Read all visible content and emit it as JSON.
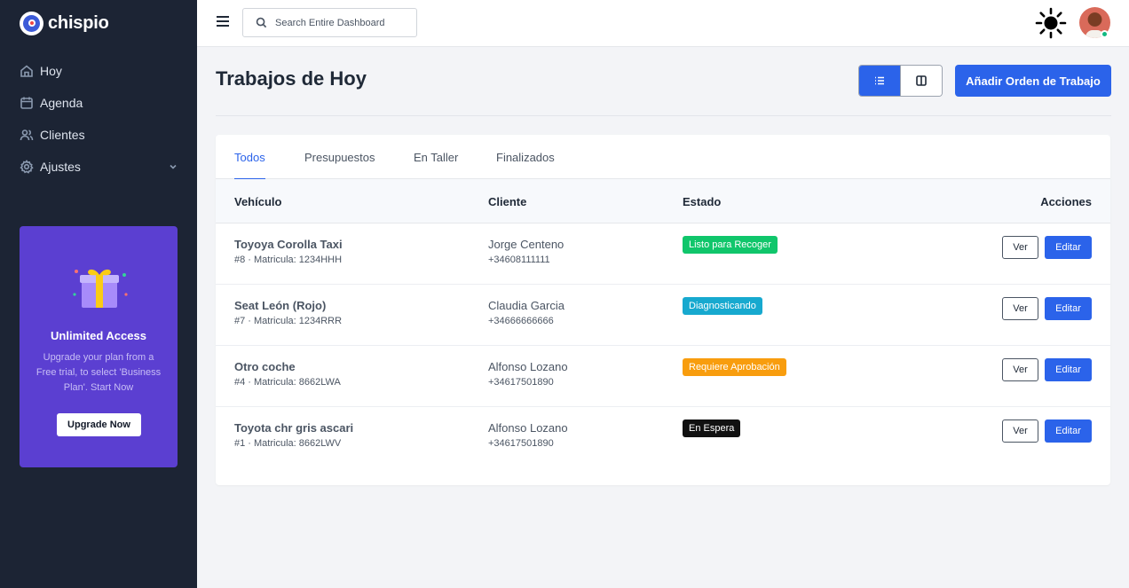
{
  "app": {
    "name": "chispio"
  },
  "sidebar": {
    "items": [
      {
        "label": "Hoy",
        "icon": "home-icon"
      },
      {
        "label": "Agenda",
        "icon": "calendar-icon"
      },
      {
        "label": "Clientes",
        "icon": "users-icon"
      },
      {
        "label": "Ajustes",
        "icon": "gear-icon"
      }
    ],
    "promo": {
      "title": "Unlimited Access",
      "text": "Upgrade your plan from a Free trial, to select 'Business Plan'. Start Now",
      "button": "Upgrade Now",
      "background": "#5b3fd1"
    }
  },
  "header": {
    "search_placeholder": "Search Entire Dashboard"
  },
  "page": {
    "title": "Trabajos de Hoy",
    "add_button": "Añadir Orden de Trabajo",
    "accent": "#2b63ea"
  },
  "tabs": [
    {
      "label": "Todos",
      "active": true
    },
    {
      "label": "Presupuestos",
      "active": false
    },
    {
      "label": "En Taller",
      "active": false
    },
    {
      "label": "Finalizados",
      "active": false
    }
  ],
  "table": {
    "columns": [
      "Vehículo",
      "Cliente",
      "Estado",
      "Acciones"
    ],
    "view_label": "Ver",
    "edit_label": "Editar",
    "rows": [
      {
        "vehicle": "Toyoya Corolla Taxi",
        "details": "#8 · Matricula: 1234HHH",
        "client": "Jorge Centeno",
        "phone": "+34608111111",
        "status": "Listo para Recoger",
        "status_color": "#10c66b"
      },
      {
        "vehicle": "Seat León (Rojo)",
        "details": "#7 · Matricula: 1234RRR",
        "client": "Claudia Garcia",
        "phone": "+34666666666",
        "status": "Diagnosticando",
        "status_color": "#17a9cf"
      },
      {
        "vehicle": "Otro coche",
        "details": "#4 · Matricula: 8662LWA",
        "client": "Alfonso Lozano",
        "phone": "+34617501890",
        "status": "Requiere Aprobación",
        "status_color": "#f89d0e"
      },
      {
        "vehicle": "Toyota chr gris ascari",
        "details": "#1 · Matricula: 8662LWV",
        "client": "Alfonso Lozano",
        "phone": "+34617501890",
        "status": "En Espera",
        "status_color": "#111111"
      }
    ]
  }
}
